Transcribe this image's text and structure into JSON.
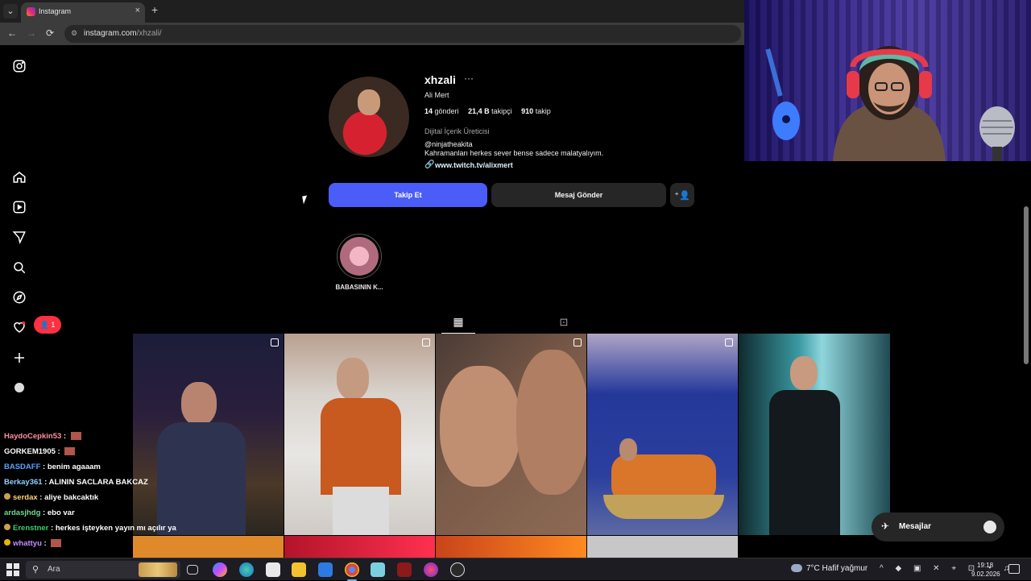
{
  "browser": {
    "tab_title": "Instagram",
    "tab_close": "×",
    "new_tab": "+",
    "url_host": "instagram.com",
    "url_path": "/xhzali/",
    "back": "←",
    "forward": "→",
    "reload": "⟳"
  },
  "profile": {
    "username": "xhzali",
    "more": "···",
    "full_name": "Ali Mert",
    "posts_count": "14",
    "posts_label": "gönderi",
    "followers_count": "21,4 B",
    "followers_label": "takipçi",
    "following_count": "910",
    "following_label": "takip",
    "category": "Dijital İçerik Üreticisi",
    "handle": "@ninjatheakita",
    "bio": "Kahramanları herkes sever bense sadece malatyalıyım.",
    "link": "www.twitch.tv/alixmert"
  },
  "actions": {
    "follow": "Takip Et",
    "message": "Mesaj Gönder"
  },
  "highlights": [
    {
      "label": "BABASININ K..."
    }
  ],
  "notifications": {
    "badge_count": "1"
  },
  "chat": [
    {
      "user": "HaydoCepkin53",
      "color": "#ff8fa0",
      "message": "",
      "emote": true
    },
    {
      "user": "GORKEM1905",
      "color": "#ffffff",
      "message": "",
      "emote": true
    },
    {
      "user": "BASDAFF",
      "color": "#5aa0ff",
      "message": "benim agaaam",
      "emote": false
    },
    {
      "user": "Berkay361",
      "color": "#8fd0ff",
      "message": "ALININ SACLARA BAKCAZ",
      "emote": false
    },
    {
      "user": "serdax",
      "color": "#ffd27a",
      "message": "aliye bakcaktık",
      "emote": false
    },
    {
      "user": "ardasjhdg",
      "color": "#6fdc8c",
      "message": "ebo var",
      "emote": false
    },
    {
      "user": "Erenstner",
      "color": "#3ccf6e",
      "message": "herkes işteyken yayın mı açılır ya",
      "emote": false
    },
    {
      "user": "whattyu",
      "color": "#c78bff",
      "message": "",
      "emote": true
    }
  ],
  "messages_pill": {
    "label": "Mesajlar"
  },
  "taskbar": {
    "search_placeholder": "Ara",
    "weather": "7°C  Hafif yağmur",
    "time": "19:18",
    "date": "9.02.2026"
  },
  "colors": {
    "follow_button": "#4a5df9",
    "secondary_button": "#262626",
    "notification": "#ff3040"
  }
}
